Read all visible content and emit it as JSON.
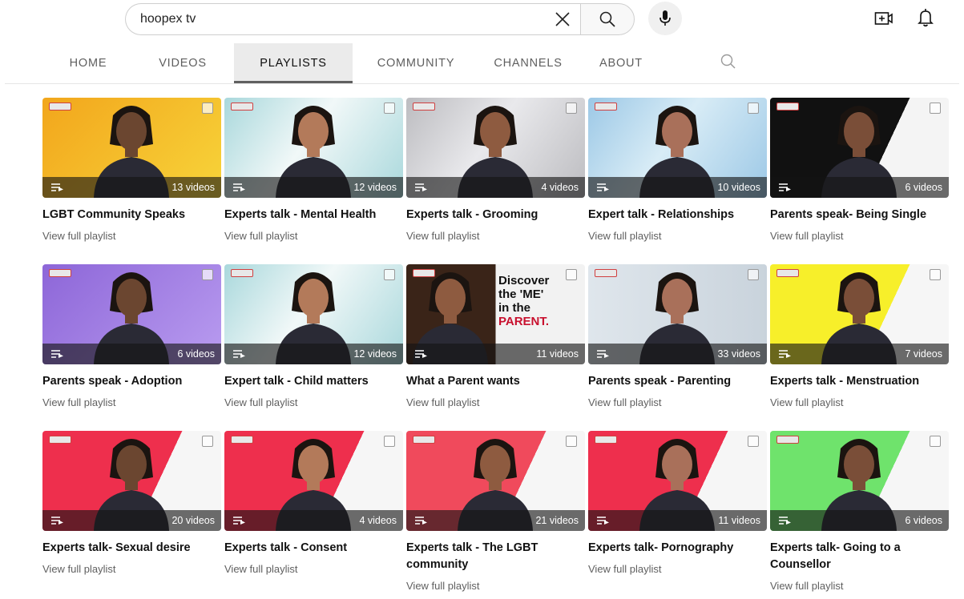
{
  "search": {
    "query": "hoopex tv"
  },
  "icons": {
    "clear": "close-icon",
    "search": "search-icon",
    "mic": "microphone-icon",
    "create": "create-video-icon",
    "bell": "notifications-icon",
    "playlist": "playlist-icon"
  },
  "tabs": [
    {
      "label": "HOME",
      "active": false
    },
    {
      "label": "VIDEOS",
      "active": false
    },
    {
      "label": "PLAYLISTS",
      "active": true
    },
    {
      "label": "COMMUNITY",
      "active": false
    },
    {
      "label": "CHANNELS",
      "active": false
    },
    {
      "label": "ABOUT",
      "active": false
    }
  ],
  "playlists": [
    {
      "title": "LGBT Community Speaks",
      "count": "13 videos",
      "link": "View full playlist",
      "bg": "#f2a61c",
      "bg2": "#f7d43a",
      "style": "gradient"
    },
    {
      "title": "Experts talk - Mental Health",
      "count": "12 videos",
      "link": "View full playlist",
      "bg": "#a9d8dc",
      "bg2": "#f1f8f8",
      "style": "diag"
    },
    {
      "title": "Experts talk - Grooming",
      "count": "4 videos",
      "link": "View full playlist",
      "bg": "#bcbcc0",
      "bg2": "#e9e9ec",
      "style": "diag"
    },
    {
      "title": "Expert talk - Relationships",
      "count": "10 videos",
      "link": "View full playlist",
      "bg": "#9cc8e6",
      "bg2": "#d8ecf6",
      "style": "diag"
    },
    {
      "title": "Parents speak- Being Single",
      "count": "6 videos",
      "link": "View full playlist",
      "bg": "#111111",
      "bg2": "#f4f4f4",
      "style": "split"
    },
    {
      "title": "Parents speak - Adoption",
      "count": "6 videos",
      "link": "View full playlist",
      "bg": "#8d66d8",
      "bg2": "#b99cf0",
      "style": "gradient"
    },
    {
      "title": "Expert talk - Child matters",
      "count": "12 videos",
      "link": "View full playlist",
      "bg": "#a9d8dc",
      "bg2": "#f1f8f8",
      "style": "diag"
    },
    {
      "title": "What a Parent wants",
      "count": "11 videos",
      "link": "View full playlist",
      "bg": "#3a2418",
      "bg2": "#f2f2f2",
      "style": "poster"
    },
    {
      "title": "Parents speak - Parenting",
      "count": "33 videos",
      "link": "View full playlist",
      "bg": "#dfe6ec",
      "bg2": "#c9d3dc",
      "style": "room"
    },
    {
      "title": "Experts talk - Menstruation",
      "count": "7 videos",
      "link": "View full playlist",
      "bg": "#f7ef2a",
      "bg2": "#f6f6f6",
      "style": "split"
    },
    {
      "title": "Experts talk- Sexual desire",
      "count": "20 videos",
      "link": "View full playlist",
      "bg": "#ee2f4d",
      "bg2": "#f6f6f6",
      "style": "split"
    },
    {
      "title": "Experts talk - Consent",
      "count": "4 videos",
      "link": "View full playlist",
      "bg": "#ee2f4d",
      "bg2": "#f6f6f6",
      "style": "split"
    },
    {
      "title": "Experts talk - The LGBT community",
      "count": "21 videos",
      "link": "View full playlist",
      "bg": "#f04a5c",
      "bg2": "#f6f6f6",
      "style": "split"
    },
    {
      "title": "Experts talk- Pornography",
      "count": "11 videos",
      "link": "View full playlist",
      "bg": "#ee2f4d",
      "bg2": "#f6f6f6",
      "style": "split"
    },
    {
      "title": "Experts talk- Going to a Counsellor",
      "count": "6 videos",
      "link": "View full playlist",
      "bg": "#6fe36c",
      "bg2": "#f6f6f6",
      "style": "split"
    }
  ],
  "poster_text": [
    "Discover",
    "the 'ME'",
    "in the",
    "PARENT."
  ]
}
